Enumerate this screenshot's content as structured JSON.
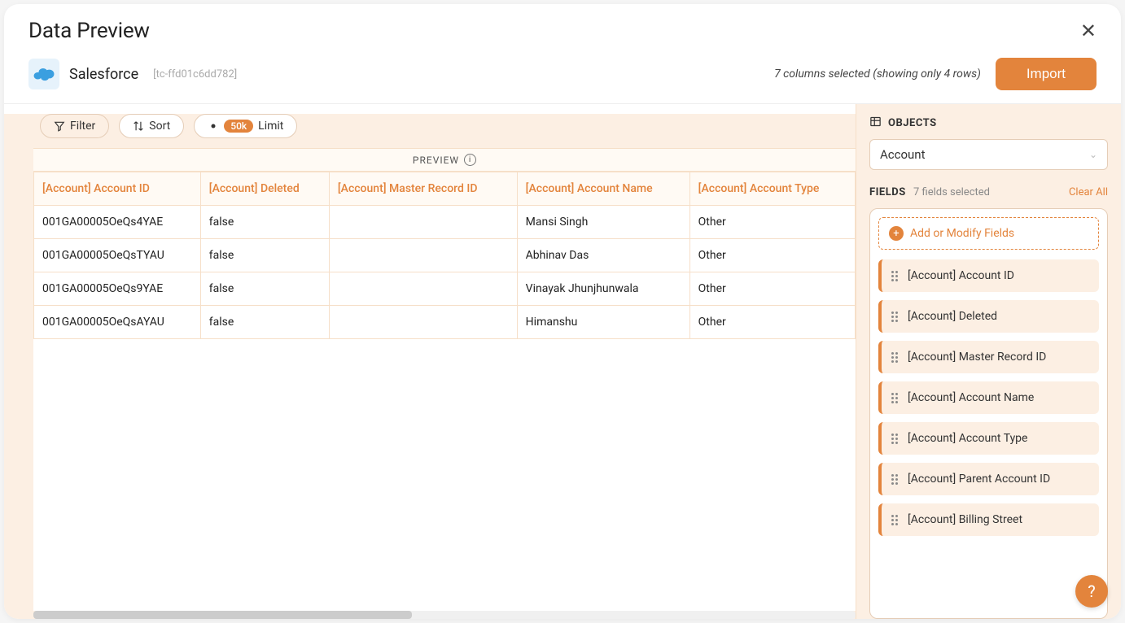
{
  "header": {
    "title": "Data Preview"
  },
  "connector": {
    "name": "Salesforce",
    "id": "[tc-ffd01c6dd782]",
    "columns_info": "7 columns selected (showing only 4 rows)",
    "import_label": "Import"
  },
  "toolbar": {
    "filter_label": "Filter",
    "sort_label": "Sort",
    "limit_tag": "50k",
    "limit_label": "Limit",
    "preview_label": "PREVIEW"
  },
  "table": {
    "columns": [
      "[Account] Account ID",
      "[Account] Deleted",
      "[Account] Master Record ID",
      "[Account] Account Name",
      "[Account] Account Type"
    ],
    "rows": [
      [
        "001GA00005OeQs4YAE",
        "false",
        "",
        "Mansi Singh",
        "Other"
      ],
      [
        "001GA00005OeQsTYAU",
        "false",
        "",
        "Abhinav Das",
        "Other"
      ],
      [
        "001GA00005OeQs9YAE",
        "false",
        "",
        "Vinayak Jhunjhunwala",
        "Other"
      ],
      [
        "001GA00005OeQsAYAU",
        "false",
        "",
        "Himanshu",
        "Other"
      ]
    ]
  },
  "sidebar": {
    "objects_label": "OBJECTS",
    "object_selected": "Account",
    "fields_label": "FIELDS",
    "fields_selected_text": "7 fields selected",
    "clear_all": "Clear All",
    "add_fields": "Add or Modify Fields",
    "fields": [
      "[Account] Account ID",
      "[Account] Deleted",
      "[Account] Master Record ID",
      "[Account] Account Name",
      "[Account] Account Type",
      "[Account] Parent Account ID",
      "[Account] Billing Street"
    ]
  }
}
